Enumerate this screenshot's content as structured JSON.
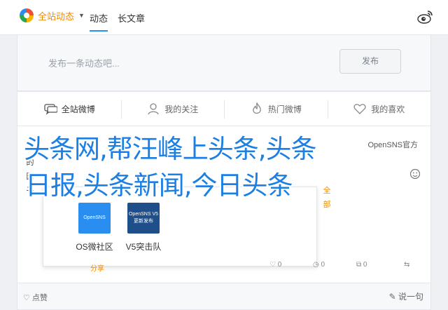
{
  "nav": {
    "site_title": "全站动态",
    "tabs": [
      {
        "label": "动态"
      },
      {
        "label": "长文章"
      }
    ]
  },
  "composer": {
    "placeholder": "发布一条动态吧...",
    "publish_label": "发布"
  },
  "filters": [
    {
      "label": "全站微博",
      "icon": "chat-icon"
    },
    {
      "label": "我的关注",
      "icon": "user-icon"
    },
    {
      "label": "热门微博",
      "icon": "flame-icon"
    },
    {
      "label": "我的喜欢",
      "icon": "heart-icon"
    }
  ],
  "feed": {
    "source": "OpenSNS官方",
    "side_name": "的\n园\n子",
    "quanbu": "全\n部",
    "products": [
      {
        "label": "OS微社区",
        "tile_lines": [
          "OpenSNS"
        ],
        "color": "#2a8ef0"
      },
      {
        "label": "V5突击队",
        "tile_lines": [
          "OpenSNS V5",
          "更新发布"
        ],
        "color": "#1e4f8a"
      }
    ],
    "follow_label": "分享",
    "action_counts": [
      "0",
      "0",
      "0"
    ]
  },
  "bottom": {
    "left_label": "点赞",
    "right_label": "说一句"
  },
  "watermark": {
    "line1": "头条网,帮汪峰上头条,头条",
    "line2": "日报,头条新闻,今日头条"
  },
  "colors": {
    "accent": "#2a8ef0",
    "brand_orange": "#f08b00",
    "watermark": "#1b7fe3"
  }
}
